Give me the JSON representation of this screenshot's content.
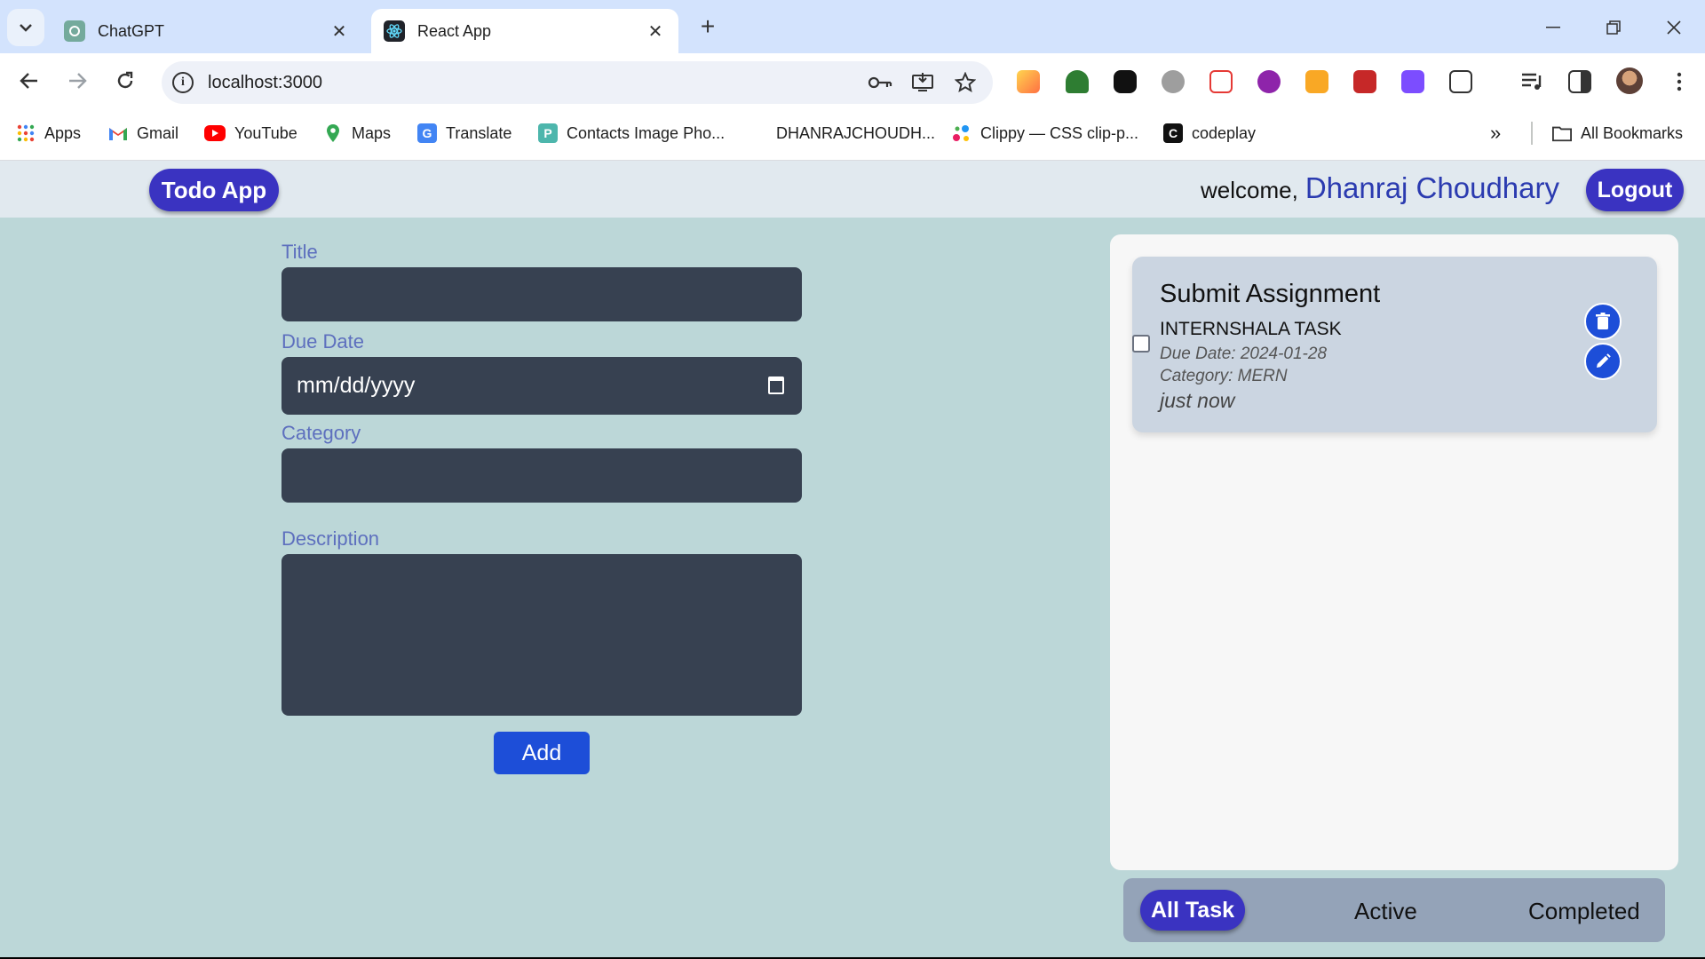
{
  "browser": {
    "tabs": [
      {
        "title": "ChatGPT",
        "active": false
      },
      {
        "title": "React App",
        "active": true
      }
    ],
    "url": "localhost:3000",
    "bookmarks": [
      {
        "label": "Apps"
      },
      {
        "label": "Gmail"
      },
      {
        "label": "YouTube"
      },
      {
        "label": "Maps"
      },
      {
        "label": "Translate"
      },
      {
        "label": "Contacts Image Pho..."
      },
      {
        "label": "DHANRAJCHOUDH..."
      },
      {
        "label": "Clippy — CSS clip-p..."
      },
      {
        "label": "codeplay"
      }
    ],
    "all_bookmarks": "All Bookmarks"
  },
  "app": {
    "brand": "Todo App",
    "welcome_text": "welcome,",
    "user_name": "Dhanraj Choudhary",
    "logout_label": "Logout",
    "form": {
      "title_label": "Title",
      "title_value": "",
      "due_label": "Due Date",
      "due_placeholder": "mm/dd/yyyy",
      "category_label": "Category",
      "category_value": "",
      "description_label": "Description",
      "description_value": "",
      "add_label": "Add"
    },
    "tasks": [
      {
        "title": "Submit Assignment",
        "description": "INTERNSHALA TASK",
        "due": "Due Date: 2024-01-28",
        "category": "Category: MERN",
        "time": "just now",
        "completed": false
      }
    ],
    "filters": {
      "all": "All Task",
      "active": "Active",
      "completed": "Completed",
      "selected": "all"
    }
  }
}
